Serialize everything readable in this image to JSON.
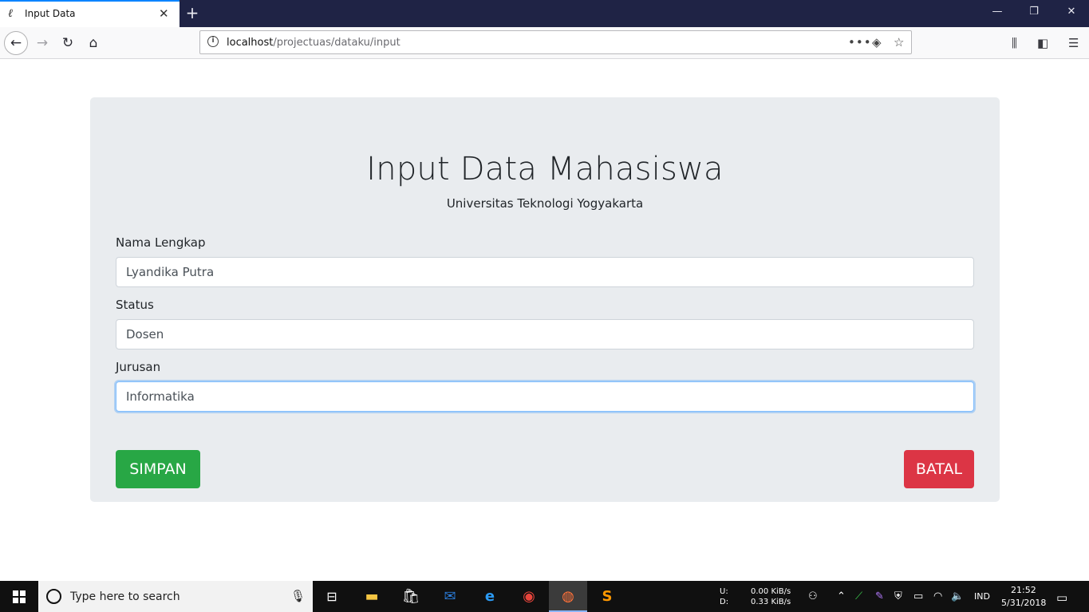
{
  "browser": {
    "tab_title": "Input Data",
    "tab_favicon": "ℓ",
    "url_host": "localhost",
    "url_path": "/projectuas/dataku/input"
  },
  "page": {
    "title": "Input Data Mahasiswa",
    "subtitle": "Universitas Teknologi Yogyakarta"
  },
  "form": {
    "nama_label": "Nama Lengkap",
    "nama_value": "Lyandika Putra",
    "status_label": "Status",
    "status_value": "Dosen",
    "jurusan_label": "Jurusan",
    "jurusan_value": "Informatika",
    "save_label": "SIMPAN",
    "cancel_label": "BATAL"
  },
  "taskbar": {
    "search_placeholder": "Type here to search",
    "net_up_label": "U:",
    "net_down_label": "D:",
    "net_up_value": "0.00 KiB/s",
    "net_down_value": "0.33 KiB/s",
    "language": "IND",
    "time": "21:52",
    "date": "5/31/2018"
  },
  "colors": {
    "save": "#28a745",
    "cancel": "#dc3545",
    "jumbotron": "#e9ecef",
    "titlebar": "#1f2345"
  }
}
